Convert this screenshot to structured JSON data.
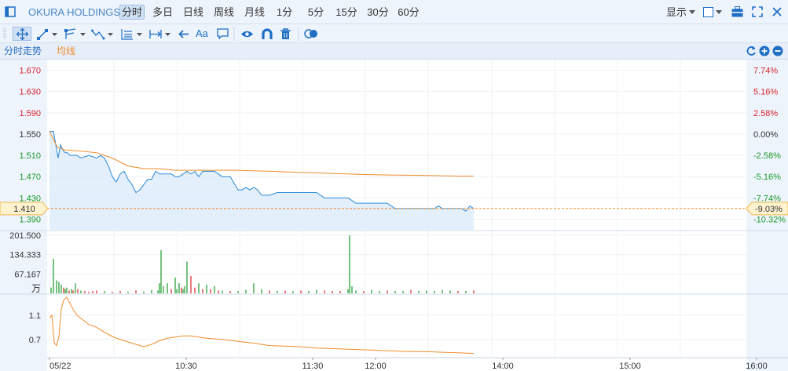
{
  "header": {
    "ticker": "OKURA HOLDINGS",
    "periods": [
      "分时",
      "多日",
      "日线",
      "周线",
      "月线",
      "1分",
      "5分",
      "15分",
      "30分",
      "60分"
    ],
    "active_period": "分时",
    "display_label": "显示"
  },
  "toolbar": {
    "tools": [
      "move-tool-icon",
      "line-tool-icon",
      "channel-tool-icon",
      "wave-tool-icon",
      "fib-tool-icon",
      "range-tool-icon",
      "back-arrow-icon",
      "text-tool-icon",
      "note-tool-icon",
      "eye-icon",
      "magnet-icon",
      "trash-icon",
      "toggle-icon"
    ],
    "text_tool_label": "Aa"
  },
  "legend": {
    "series1": "分时走势",
    "series2": "均线"
  },
  "colors": {
    "price_line": "#2a8ad8",
    "avg_line": "#f08c2a",
    "up": "#d9232b",
    "down": "#1a9a2a",
    "ref_line": "#f08c2a"
  },
  "chart_data": [
    {
      "type": "line",
      "title": "",
      "y_left_labels": [
        "1.670",
        "1.630",
        "1.590",
        "1.550",
        "1.510",
        "1.470",
        "1.430",
        "1.390"
      ],
      "y_right_labels": [
        "7.74%",
        "5.16%",
        "2.58%",
        "0.00%",
        "-2.58%",
        "-5.16%",
        "-7.74%",
        "-10.32%"
      ],
      "ylim": [
        1.37,
        1.69
      ],
      "reference_price": 1.55,
      "current_price_label": "1.410",
      "current_pct_label": "-9.03%",
      "series": [
        {
          "name": "分时走势",
          "x": [
            0,
            5,
            8,
            11,
            14,
            17,
            20,
            23,
            26,
            29,
            32,
            35,
            40,
            50,
            60,
            65,
            70,
            75,
            80,
            85,
            90,
            95,
            100,
            105,
            110,
            115,
            120,
            125,
            130,
            135,
            140,
            145,
            150,
            155,
            160,
            165,
            170,
            175,
            180,
            185,
            190,
            195,
            200,
            210,
            220,
            230,
            240,
            245,
            250,
            255,
            260,
            265,
            270,
            280,
            290,
            300,
            310,
            320,
            330,
            340,
            350,
            360,
            370,
            380,
            390,
            400,
            410,
            420,
            430,
            440,
            450,
            455,
            460,
            465,
            470,
            475,
            480,
            485,
            490,
            495,
            500,
            505,
            510,
            515,
            520,
            525,
            530,
            535,
            540
          ],
          "values": [
            1.555,
            1.555,
            1.53,
            1.505,
            1.53,
            1.52,
            1.515,
            1.515,
            1.51,
            1.51,
            1.51,
            1.51,
            1.505,
            1.51,
            1.505,
            1.51,
            1.505,
            1.49,
            1.47,
            1.46,
            1.475,
            1.48,
            1.465,
            1.455,
            1.44,
            1.445,
            1.455,
            1.465,
            1.465,
            1.48,
            1.475,
            1.475,
            1.475,
            1.475,
            1.47,
            1.47,
            1.475,
            1.48,
            1.475,
            1.48,
            1.47,
            1.48,
            1.48,
            1.48,
            1.47,
            1.47,
            1.445,
            1.445,
            1.45,
            1.445,
            1.45,
            1.445,
            1.435,
            1.435,
            1.44,
            1.44,
            1.44,
            1.44,
            1.44,
            1.44,
            1.43,
            1.43,
            1.43,
            1.43,
            1.42,
            1.42,
            1.42,
            1.42,
            1.42,
            1.41,
            1.41,
            1.41,
            1.41,
            1.41,
            1.41,
            1.41,
            1.41,
            1.41,
            1.41,
            1.415,
            1.41,
            1.41,
            1.41,
            1.41,
            1.41,
            1.41,
            1.405,
            1.415,
            1.41
          ]
        },
        {
          "name": "均线",
          "x": [
            0,
            10,
            20,
            40,
            60,
            80,
            100,
            120,
            140,
            160,
            180,
            200,
            240,
            280,
            320,
            360,
            400,
            440,
            480,
            520,
            540
          ],
          "values": [
            1.555,
            1.525,
            1.52,
            1.518,
            1.515,
            1.505,
            1.49,
            1.485,
            1.485,
            1.482,
            1.482,
            1.482,
            1.482,
            1.48,
            1.478,
            1.476,
            1.474,
            1.473,
            1.472,
            1.471,
            1.471
          ]
        }
      ]
    },
    {
      "type": "bar",
      "title": "",
      "y_labels": [
        "201.500",
        "134.333",
        "67.167"
      ],
      "unit_label": "万",
      "ylim": [
        0,
        201.5
      ],
      "series": [
        {
          "x": [
            2,
            5,
            9,
            12,
            15,
            18,
            20,
            22,
            25,
            28,
            30,
            33,
            36,
            40,
            45,
            50,
            55,
            60,
            70,
            80,
            90,
            100,
            110,
            120,
            130,
            138,
            140,
            142,
            145,
            150,
            155,
            160,
            162,
            165,
            168,
            170,
            172,
            175,
            180,
            185,
            190,
            195,
            200,
            205,
            210,
            215,
            220,
            230,
            240,
            250,
            260,
            270,
            280,
            290,
            300,
            310,
            320,
            330,
            340,
            350,
            360,
            370,
            380,
            382,
            385,
            390,
            400,
            410,
            420,
            430,
            440,
            450,
            460,
            470,
            480,
            490,
            500,
            510,
            520,
            530,
            540
          ],
          "values": [
            20,
            120,
            45,
            40,
            30,
            20,
            15,
            20,
            10,
            15,
            10,
            35,
            15,
            10,
            8,
            5,
            8,
            10,
            8,
            5,
            8,
            5,
            10,
            6,
            12,
            10,
            35,
            150,
            25,
            35,
            15,
            55,
            15,
            35,
            20,
            15,
            25,
            110,
            60,
            20,
            35,
            15,
            30,
            15,
            25,
            10,
            10,
            8,
            8,
            12,
            35,
            15,
            10,
            8,
            10,
            8,
            10,
            8,
            12,
            10,
            8,
            8,
            15,
            201.5,
            25,
            10,
            8,
            12,
            8,
            10,
            8,
            8,
            12,
            8,
            10,
            8,
            12,
            10,
            8,
            8,
            10
          ],
          "colors": [
            "d",
            "d",
            "d",
            "d",
            "d",
            "u",
            "d",
            "d",
            "u",
            "d",
            "u",
            "d",
            "u",
            "d",
            "u",
            "u",
            "u",
            "u",
            "d",
            "u",
            "u",
            "d",
            "u",
            "d",
            "d",
            "d",
            "d",
            "d",
            "d",
            "d",
            "u",
            "d",
            "d",
            "d",
            "u",
            "d",
            "d",
            "d",
            "u",
            "u",
            "d",
            "u",
            "d",
            "u",
            "d",
            "u",
            "d",
            "u",
            "d",
            "d",
            "d",
            "d",
            "u",
            "d",
            "u",
            "d",
            "u",
            "d",
            "d",
            "u",
            "u",
            "u",
            "d",
            "d",
            "d",
            "d",
            "u",
            "d",
            "d",
            "u",
            "d",
            "d",
            "u",
            "d",
            "d",
            "d",
            "d",
            "d",
            "u",
            "d",
            "u"
          ]
        }
      ]
    },
    {
      "type": "line",
      "title": "",
      "y_labels": [
        "1.1",
        "0.7"
      ],
      "ylim": [
        0.4,
        1.45
      ],
      "x_tick_labels": [
        "05/22",
        "10:30",
        "11:30",
        "12:00",
        "14:00",
        "15:00",
        "16:00"
      ],
      "series": [
        {
          "x": [
            0,
            3,
            6,
            9,
            12,
            15,
            18,
            22,
            26,
            30,
            35,
            40,
            50,
            60,
            70,
            80,
            90,
            100,
            110,
            120,
            130,
            140,
            150,
            160,
            170,
            180,
            190,
            200,
            220,
            240,
            260,
            280,
            300,
            320,
            340,
            360,
            380,
            400,
            420,
            440,
            460,
            480,
            500,
            520,
            540
          ],
          "values": [
            1.05,
            1.1,
            0.65,
            0.6,
            0.75,
            1.2,
            1.35,
            1.4,
            1.3,
            1.2,
            1.1,
            1.05,
            0.95,
            0.9,
            0.82,
            0.75,
            0.7,
            0.66,
            0.62,
            0.58,
            0.62,
            0.68,
            0.72,
            0.74,
            0.76,
            0.76,
            0.74,
            0.72,
            0.7,
            0.67,
            0.64,
            0.6,
            0.59,
            0.58,
            0.56,
            0.55,
            0.54,
            0.53,
            0.52,
            0.51,
            0.5,
            0.5,
            0.49,
            0.48,
            0.47
          ]
        }
      ]
    }
  ]
}
